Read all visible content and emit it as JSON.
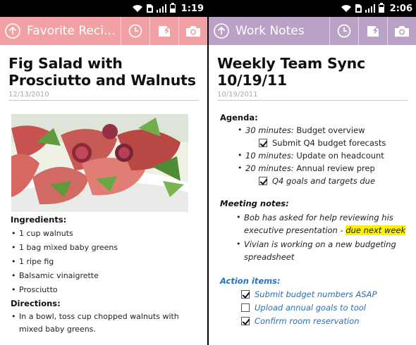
{
  "left": {
    "status": {
      "time": "1:19"
    },
    "appbar": {
      "title": "Favorite Reci…",
      "color": "#f1a0a3"
    },
    "note": {
      "title": "Fig Salad with Prosciutto and Walnuts",
      "date": "12/13/2010",
      "image": "fig-salad-photo",
      "ingredients_heading": "Ingredients:",
      "ingredients": [
        "1 cup walnuts",
        "1 bag mixed baby greens",
        "1 ripe fig",
        "Balsamic vinaigrette",
        "Prosciutto"
      ],
      "directions_heading": "Directions:",
      "directions": [
        "In a bowl, toss cup chopped walnuts with mixed baby greens."
      ]
    }
  },
  "right": {
    "status": {
      "time": "2:06"
    },
    "appbar": {
      "title": "Work Notes",
      "color": "#baa1c6"
    },
    "note": {
      "title": "Weekly Team Sync 10/19/11",
      "date": "10/19/2011",
      "agenda_heading": "Agenda:",
      "agenda": [
        {
          "duration": "30 minutes:",
          "text": " Budget overview"
        },
        {
          "duration": "10 minutes:",
          "text": " Update on headcount"
        },
        {
          "duration": "20 minutes:",
          "text": " Annual review prep"
        }
      ],
      "agenda_tasks": [
        {
          "label": "Submit Q4 budget forecasts",
          "checked": true
        },
        {
          "label": "Q4 goals and targets due",
          "checked": true
        }
      ],
      "meeting_heading": "Meeting notes:",
      "meeting_notes": {
        "item1_text": "Bob has asked for help reviewing his executive presentation - ",
        "item1_highlight": "due next week",
        "item2_text": "Vivian is working on a new budgeting spreadsheet"
      },
      "action_heading": "Action items:",
      "action_items": [
        {
          "label": "Submit budget numbers ASAP",
          "checked": true
        },
        {
          "label": "Upload annual goals to tool",
          "checked": false
        },
        {
          "label": "Confirm room reservation",
          "checked": true
        }
      ],
      "link_color": "#2a6fb5",
      "highlight_color": "#fff200"
    }
  }
}
